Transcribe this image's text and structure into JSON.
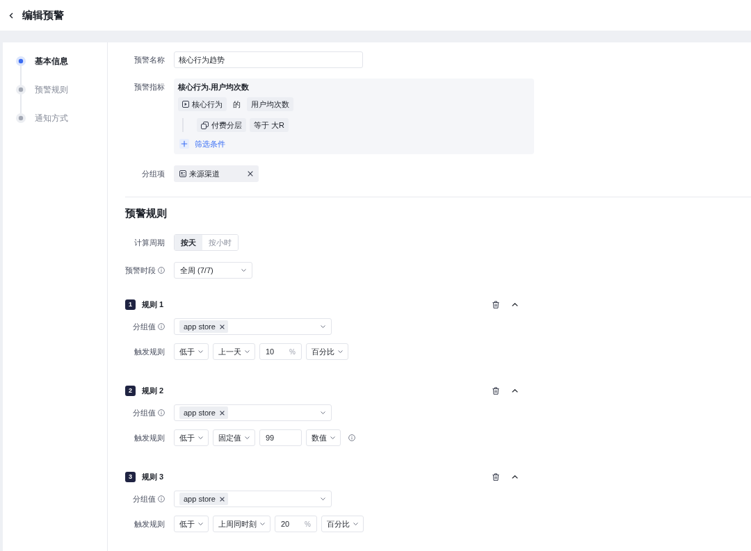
{
  "header": {
    "title": "编辑预警"
  },
  "steps": [
    {
      "label": "基本信息",
      "selected": true
    },
    {
      "label": "预警规则",
      "selected": false
    },
    {
      "label": "通知方式",
      "selected": false
    }
  ],
  "basic_info": {
    "name": {
      "label": "预警名称",
      "value": "核心行为趋势"
    },
    "metric": {
      "label": "预警指标",
      "title": "核心行为.用户均次数",
      "event": "核心行为",
      "connector": "的",
      "measure": "用户均次数",
      "filters": [
        {
          "property": "付费分层",
          "condition": "等于 大R"
        }
      ],
      "add_filter": "筛选条件"
    },
    "group_by": {
      "label": "分组项",
      "tags": [
        "来源渠道"
      ]
    }
  },
  "rule_settings": {
    "title": "预警规则",
    "period": {
      "label": "计算周期",
      "options": [
        {
          "label": "按天",
          "selected": true
        },
        {
          "label": "按小时",
          "selected": false
        }
      ]
    },
    "time_window": {
      "label": "预警时段",
      "value": "全周 (7/7)"
    },
    "rules": [
      {
        "number": "1",
        "title": "规则 1",
        "expanded": true,
        "group_value": {
          "label": "分组值",
          "tags": [
            "app store"
          ]
        },
        "trigger": {
          "label": "触发规则",
          "fields": [
            {
              "kind": "select",
              "value": "低于"
            },
            {
              "kind": "select",
              "value": "上一天"
            },
            {
              "kind": "input",
              "value": "10",
              "suffix": "%"
            },
            {
              "kind": "select",
              "value": "百分比"
            }
          ],
          "hint": false
        }
      },
      {
        "number": "2",
        "title": "规则 2",
        "expanded": true,
        "group_value": {
          "label": "分组值",
          "tags": [
            "app store"
          ]
        },
        "trigger": {
          "label": "触发规则",
          "fields": [
            {
              "kind": "select",
              "value": "低于"
            },
            {
              "kind": "select",
              "value": "固定值"
            },
            {
              "kind": "input",
              "value": "99"
            },
            {
              "kind": "select",
              "value": "数值"
            }
          ],
          "hint": true
        }
      },
      {
        "number": "3",
        "title": "规则 3",
        "expanded": true,
        "group_value": {
          "label": "分组值",
          "tags": [
            "app store"
          ]
        },
        "trigger": {
          "label": "触发规则",
          "fields": [
            {
              "kind": "select",
              "value": "低于"
            },
            {
              "kind": "select",
              "value": "上周同时刻"
            },
            {
              "kind": "input",
              "value": "20",
              "suffix": "%"
            },
            {
              "kind": "select",
              "value": "百分比"
            }
          ],
          "hint": false
        }
      }
    ]
  }
}
